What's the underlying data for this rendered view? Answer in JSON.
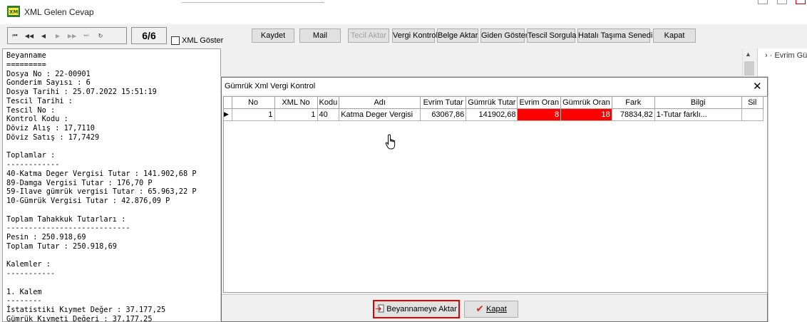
{
  "window": {
    "title": "XML Gelen Cevap",
    "icon": "app-xml-icon"
  },
  "toolbar": {
    "nav": [
      "first",
      "prev-page",
      "prev",
      "next",
      "next-page",
      "last",
      "refresh"
    ],
    "page": "6/6",
    "xml_goster": "XML Göster",
    "buttons": {
      "kaydet": "Kaydet",
      "mail": "Mail",
      "tecil_aktar": "Tecil Aktar",
      "vergi_kontrol": "Vergi Kontrol",
      "belge_aktar": "Belge Aktar",
      "giden_goster": "Giden Göster",
      "tescil_sorgula": "Tescil Sorgula",
      "hatali_tasima": "Hatalı Taşıma Senedi",
      "kapat": "Kapat"
    }
  },
  "beyanname_text": "Beyanname\n=========\nDosya No : 22-00901\nGonderim Sayısı : 6\nDosya Tarihi : 25.07.2022 15:51:19\nTescil Tarihi :\nTescil No :\nKontrol Kodu :\nDöviz Alış : 17,7110\nDöviz Satış : 17,7429\n\nToplamlar :\n------------\n40-Katma Deger Vergisi Tutar : 141.902,68 P\n89-Damga Vergisi Tutar : 176,70 P\n59-Ilave gümrük vergisi Tutar : 65.963,22 P\n10-Gümrük Vergisi Tutar : 42.876,09 P\n\nToplam Tahakkuk Tutarları :\n----------------------------\nPesin : 250.918,69\nToplam Tutar : 250.918,69\n\nKalemler :\n-----------\n\n1. Kalem\n--------\nİstatistiki Kıymet Değer : 37.177,25\nGümrük Kıymeti Değeri : 37.177,25",
  "right_panel": {
    "label": "Evrim Gü"
  },
  "dialog": {
    "title": "Gümrük Xml Vergi Kontrol",
    "close": "✕",
    "columns": [
      "No",
      "XML No",
      "Kodu",
      "Adı",
      "Evrim Tutar",
      "Gümrük Tutar",
      "Evrim Oran",
      "Gümrük Oran",
      "Fark",
      "Bilgi",
      "Sil"
    ],
    "rows": [
      {
        "no": "1",
        "xml_no": "1",
        "kodu": "40",
        "adi": "Katma Deger Vergisi",
        "evrim_tutar": "63067,86",
        "gumruk_tutar": "141902,68",
        "evrim_oran": "8",
        "gumruk_oran": "18",
        "fark": "78834,82",
        "bilgi": "1-Tutar farklı...",
        "sil": ""
      }
    ],
    "buttons": {
      "aktar": "Beyannameye Aktar",
      "kapat": "Kapat"
    },
    "colors": {
      "mismatch": "#ff0000",
      "highlight_outline": "#e00000"
    }
  }
}
